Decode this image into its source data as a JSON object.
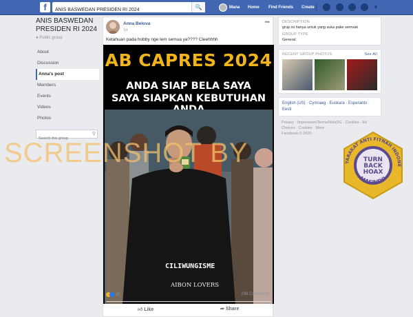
{
  "topbar": {
    "logo": "f",
    "search_value": "ANIS BASWEDAN PRESIDEN RI 2024",
    "nav": [
      "Mana",
      "Home",
      "Find Friends",
      "Create"
    ]
  },
  "group": {
    "title": "ANIS BASWEDAN PRESIDEN RI 2024",
    "privacy": "Public group",
    "nav": [
      "About",
      "Discussion",
      "Anna's post",
      "Members",
      "Events",
      "Videos",
      "Photos"
    ],
    "search_placeholder": "Search this group"
  },
  "post": {
    "author": "Anna Belova",
    "time": "1d",
    "text": "Ketahuan pada hobby nge lem semua ya???? Cleehhhh",
    "image": {
      "headline": "AB CAPRES 2024",
      "line1": "ANDA SIAP BELA SAYA",
      "line2": "SAYA SIAPKAN KEBUTUHAN ANDA",
      "shirt_text1": "CILIWUNGISME",
      "shirt_text2": "AIBON LOVERS",
      "shirt_text3": "SE"
    },
    "reactions_count": "20",
    "comments_count": "238 Comments",
    "like_label": "Like",
    "share_label": "Share"
  },
  "sidebar": {
    "description_head": "DESCRIPTION",
    "description_text": "grup ini hanya untuk yang suka pake semvak",
    "type_head": "GROUP TYPE",
    "type_text": "General",
    "photos_head": "RECENT GROUP PHOTOS",
    "photos_more": "See All",
    "languages": "English (US) · Cymraeg · Euskara · Esperanto · Eesti",
    "footer1": "Privacy · Impressum/Terms/NetzDG · Cookies · Ad Choices · Cookies · More",
    "footer2": "Facebook © 2020"
  },
  "watermark": "SCREENSHOT BY",
  "badge": {
    "center_lines": [
      "TURN",
      "BACK",
      "HOAX"
    ],
    "ring_text": "MASYARAKAT ANTI FITNAH INDONESIA",
    "bottom_text": "MAFINDO"
  },
  "colors": {
    "fb_blue": "#4267b2",
    "headline_yellow": "#f2b41b",
    "watermark": "#f5c06a",
    "badge_gold": "#e8b72a",
    "badge_purple": "#5b4a8c"
  }
}
